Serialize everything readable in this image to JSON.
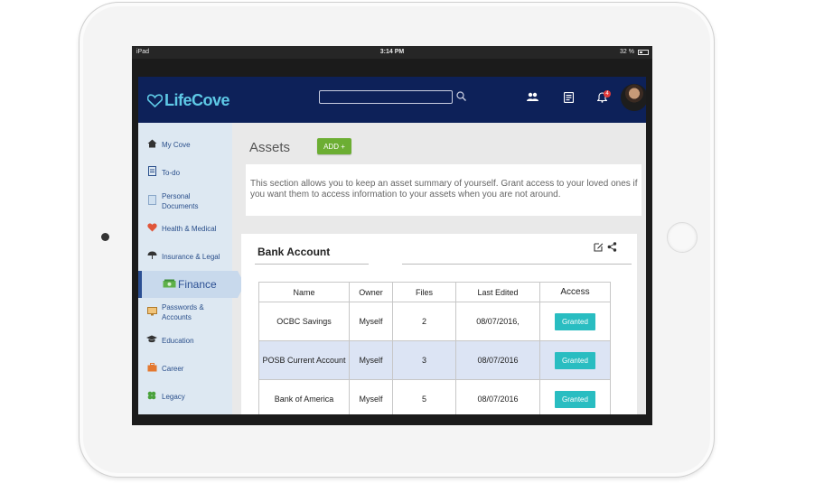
{
  "status_bar": {
    "device": "iPad",
    "time": "3:14 PM",
    "battery": "32 %"
  },
  "header": {
    "brand": "LifeCove",
    "search": {
      "value": "",
      "placeholder": ""
    },
    "notification_count": "4"
  },
  "sidebar": {
    "items": [
      {
        "label": "My Cove",
        "icon": "home-icon"
      },
      {
        "label": "To-do",
        "icon": "todo-icon"
      },
      {
        "label_line1": "Personal",
        "label_line2": "Documents",
        "icon": "documents-icon"
      },
      {
        "label": "Health & Medical",
        "icon": "heart-pulse-icon"
      },
      {
        "label": "Insurance & Legal",
        "icon": "umbrella-icon"
      },
      {
        "label": "Finance",
        "icon": "money-icon",
        "active": true
      },
      {
        "label_line1": "Passwords &",
        "label_line2": "Accounts",
        "icon": "monitor-icon"
      },
      {
        "label": "Education",
        "icon": "graduation-cap-icon"
      },
      {
        "label": "Career",
        "icon": "briefcase-icon"
      },
      {
        "label": "Legacy",
        "icon": "clover-icon"
      }
    ]
  },
  "main": {
    "title": "Assets",
    "add_label": "ADD +",
    "description": "This section allows you to keep an asset summary of yourself. Grant access to your loved ones if you want them to access information to your assets when you are not around.",
    "card": {
      "title": "Bank Account",
      "columns": [
        "Name",
        "Owner",
        "Files",
        "Last Edited",
        "Access"
      ],
      "rows": [
        {
          "name": "OCBC Savings",
          "owner": "Myself",
          "files": "2",
          "last_edited": "08/07/2016,",
          "access": "Granted"
        },
        {
          "name": "POSB Current Account",
          "owner": "Myself",
          "files": "3",
          "last_edited": "08/07/2016",
          "access": "Granted"
        },
        {
          "name": "Bank of America",
          "owner": "Myself",
          "files": "5",
          "last_edited": "08/07/2016",
          "access": "Granted"
        }
      ]
    }
  },
  "colors": {
    "header_bg": "#0d2159",
    "brand": "#5ec9e6",
    "add_button": "#6cae33",
    "granted": "#29bdc1",
    "sidebar_bg": "#dde8f2"
  }
}
